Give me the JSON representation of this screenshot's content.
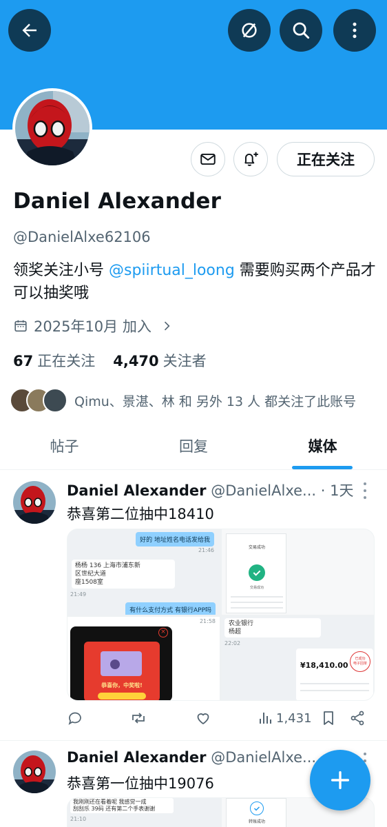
{
  "topbar": {
    "icons": [
      "back-arrow-icon",
      "hide-icon",
      "search-icon",
      "more-vertical-icon"
    ]
  },
  "profile": {
    "name": "Daniel Alexander",
    "handle": "@DanielAlxe62106",
    "bio_prefix": "领奖关注小号 ",
    "bio_mention": "@spiirtual_loong",
    "bio_suffix": " 需要购买两个产品才可以抽奖哦",
    "joined": "2025年10月 加入",
    "following_count": "67",
    "following_label": "正在关注",
    "followers_count": "4,470",
    "followers_label": "关注者",
    "followed_by": "Qimu、景湛、林 和 另外 13 人 都关注了此账号",
    "follow_button": "正在关注"
  },
  "tabs": [
    {
      "label": "帖子",
      "active": false
    },
    {
      "label": "回复",
      "active": false
    },
    {
      "label": "媒体",
      "active": true
    }
  ],
  "tweets": [
    {
      "name": "Daniel Alexander",
      "handle": "@DanielAlxe...",
      "time": "· 1天",
      "text": "恭喜第二位抽中18410",
      "views": "1,431",
      "media": {
        "chat_bubble_1": "好的 地址姓名电话发给我",
        "chat_time_1": "21:46",
        "chat_name": "杨杨 136",
        "chat_addr_1": "上海市浦东新",
        "chat_addr_2": "区世纪大道",
        "chat_addr_3": "座1508室",
        "chat_time_2": "21:49",
        "chat_bubble_2": "有什么支付方式 有银行APP吗",
        "pay_title": "交易成功",
        "pay_status": "交易成功",
        "bank_text_1": "农业银行",
        "bank_text_2": "杨超",
        "bank_time": "22:02",
        "popup_text": "恭喜你，中奖啦!",
        "phone_time": "21:58",
        "amount": "¥18,410.00",
        "stamp": "已成功\n电子回单"
      }
    },
    {
      "name": "Daniel Alexander",
      "handle": "@DanielAlxe...",
      "text": "恭喜第一位抽中19076",
      "media": {
        "chat_line_1": "我刚刚还在看着呢 我感觉一成",
        "chat_line_2": "刮刮乐 39码 还有第二个手表谢谢",
        "chat_time": "21:10",
        "pay_label": "转账成功"
      }
    }
  ],
  "colors": {
    "accent": "#1d9bf0",
    "dark_button": "#0f3a55",
    "secondary_text": "#536471"
  }
}
